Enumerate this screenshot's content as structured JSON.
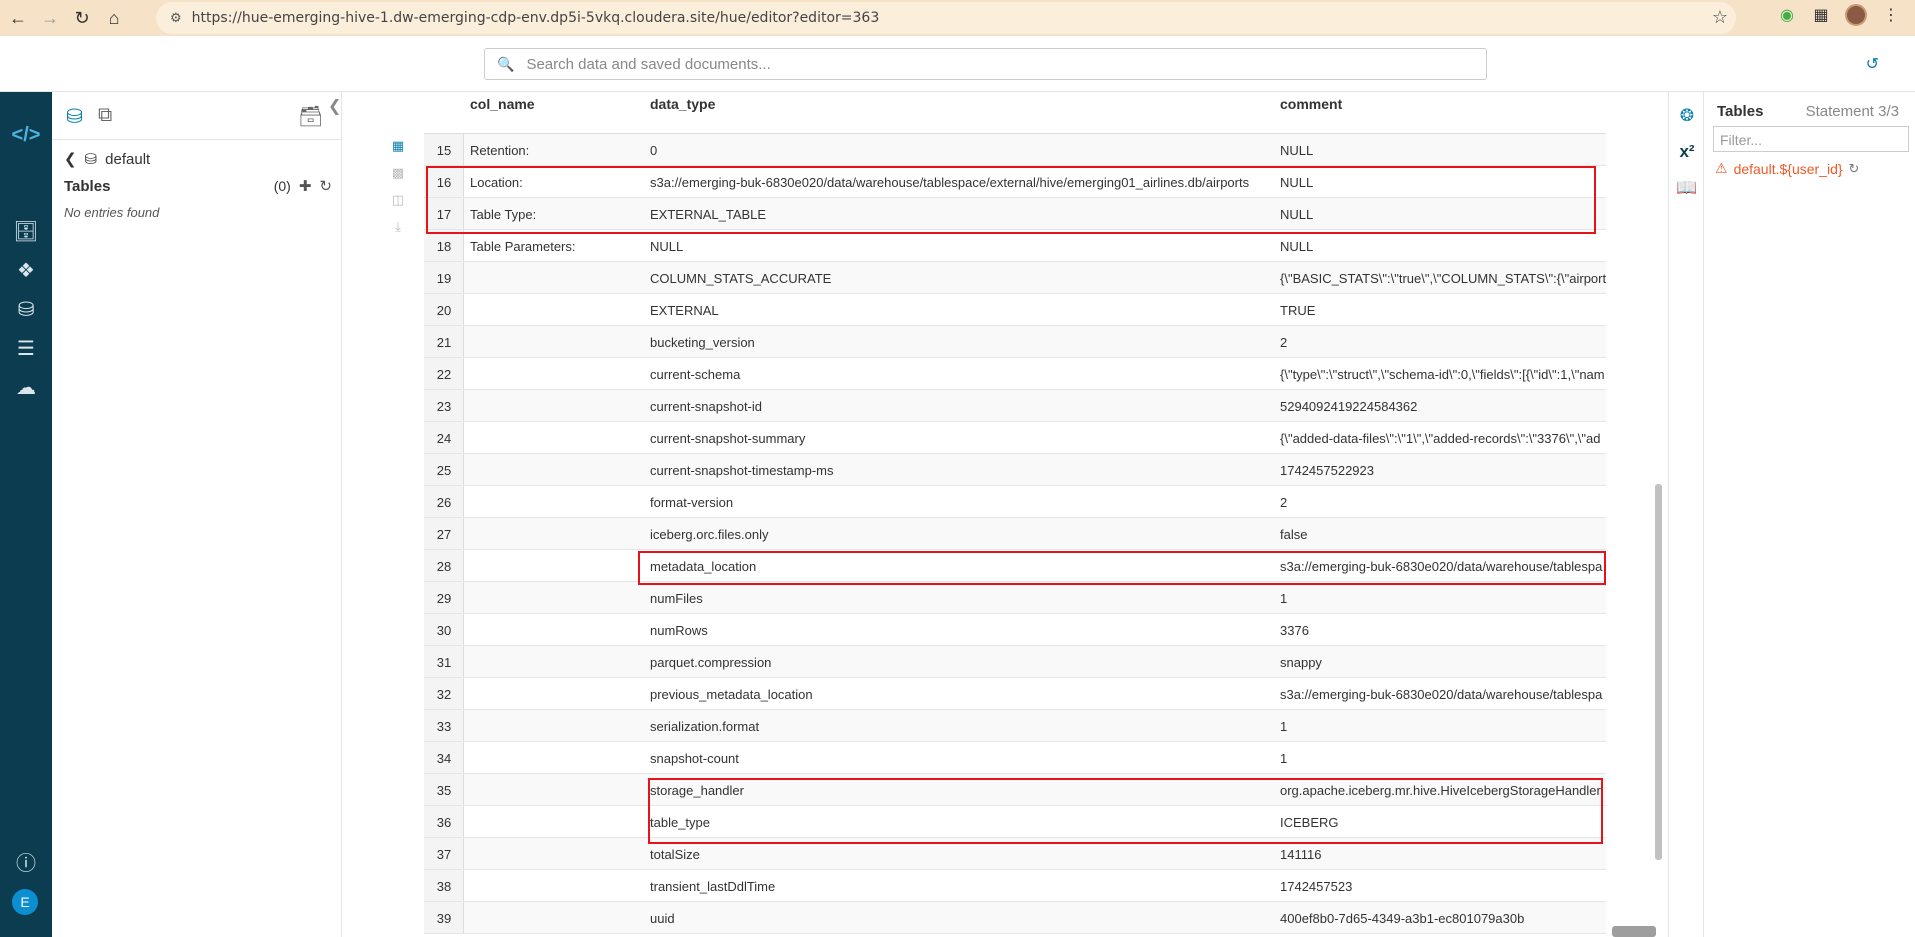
{
  "browser": {
    "url": "https://hue-emerging-hive-1.dw-emerging-cdp-env.dp5i-5vkq.cloudera.site/hue/editor?editor=363"
  },
  "topbar": {
    "search_placeholder": "Search data and saved documents..."
  },
  "rail": {
    "user_initial": "E"
  },
  "assist": {
    "database": "default",
    "tables_label": "Tables",
    "tables_count": "(0)",
    "empty_text": "No entries found"
  },
  "grid": {
    "headers": [
      "col_name",
      "data_type",
      "comment"
    ],
    "rows": [
      [
        "15",
        "Retention:",
        "0",
        "NULL"
      ],
      [
        "16",
        "Location:",
        "s3a://emerging-buk-6830e020/data/warehouse/tablespace/external/hive/emerging01_airlines.db/airports",
        "NULL"
      ],
      [
        "17",
        "Table Type:",
        "EXTERNAL_TABLE",
        "NULL"
      ],
      [
        "18",
        "Table Parameters:",
        "NULL",
        "NULL"
      ],
      [
        "19",
        "",
        "COLUMN_STATS_ACCURATE",
        "{\\\"BASIC_STATS\\\":\\\"true\\\",\\\"COLUMN_STATS\\\":{\\\"airport\\\""
      ],
      [
        "20",
        "",
        "EXTERNAL",
        "TRUE"
      ],
      [
        "21",
        "",
        "bucketing_version",
        "2"
      ],
      [
        "22",
        "",
        "current-schema",
        "{\\\"type\\\":\\\"struct\\\",\\\"schema-id\\\":0,\\\"fields\\\":[{\\\"id\\\":1,\\\"nam"
      ],
      [
        "23",
        "",
        "current-snapshot-id",
        "5294092419224584362"
      ],
      [
        "24",
        "",
        "current-snapshot-summary",
        "{\\\"added-data-files\\\":\\\"1\\\",\\\"added-records\\\":\\\"3376\\\",\\\"ad"
      ],
      [
        "25",
        "",
        "current-snapshot-timestamp-ms",
        "1742457522923"
      ],
      [
        "26",
        "",
        "format-version",
        "2"
      ],
      [
        "27",
        "",
        "iceberg.orc.files.only",
        "false"
      ],
      [
        "28",
        "",
        "metadata_location",
        "s3a://emerging-buk-6830e020/data/warehouse/tablespa"
      ],
      [
        "29",
        "",
        "numFiles",
        "1"
      ],
      [
        "30",
        "",
        "numRows",
        "3376"
      ],
      [
        "31",
        "",
        "parquet.compression",
        "snappy"
      ],
      [
        "32",
        "",
        "previous_metadata_location",
        "s3a://emerging-buk-6830e020/data/warehouse/tablespa"
      ],
      [
        "33",
        "",
        "serialization.format",
        "1"
      ],
      [
        "34",
        "",
        "snapshot-count",
        "1"
      ],
      [
        "35",
        "",
        "storage_handler",
        "org.apache.iceberg.mr.hive.HiveIcebergStorageHandler"
      ],
      [
        "36",
        "",
        "table_type",
        "ICEBERG"
      ],
      [
        "37",
        "",
        "totalSize",
        "141116"
      ],
      [
        "38",
        "",
        "transient_lastDdlTime",
        "1742457523"
      ],
      [
        "39",
        "",
        "uuid",
        "400ef8b0-7d65-4349-a3b1-ec801079a30b"
      ]
    ]
  },
  "right_panel": {
    "title": "Tables",
    "statement": "Statement 3/3",
    "filter_placeholder": "Filter...",
    "warning_table": "default.${user_id}"
  }
}
